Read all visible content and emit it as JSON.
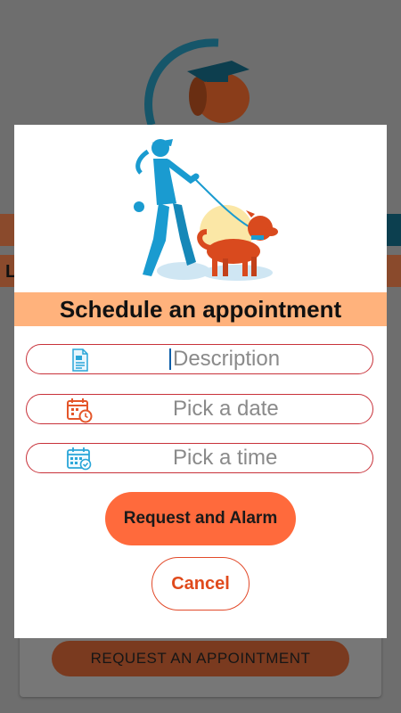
{
  "background": {
    "partial_letter": "L",
    "request_button_label": "REQUEST AN APPOINTMENT"
  },
  "dialog": {
    "title": "Schedule an appointment",
    "fields": [
      {
        "icon": "document-icon",
        "placeholder": "Description"
      },
      {
        "icon": "calendar-clock-icon",
        "placeholder": "Pick a date"
      },
      {
        "icon": "calendar-check-icon",
        "placeholder": "Pick a time"
      }
    ],
    "primary_button": "Request and Alarm",
    "cancel_button": "Cancel"
  },
  "colors": {
    "title_band": "#ffb27c",
    "field_border": "#c8323a",
    "primary_button": "#ff6a3c",
    "cancel_text": "#e04a1c",
    "overlay": "#6e6e6e"
  }
}
